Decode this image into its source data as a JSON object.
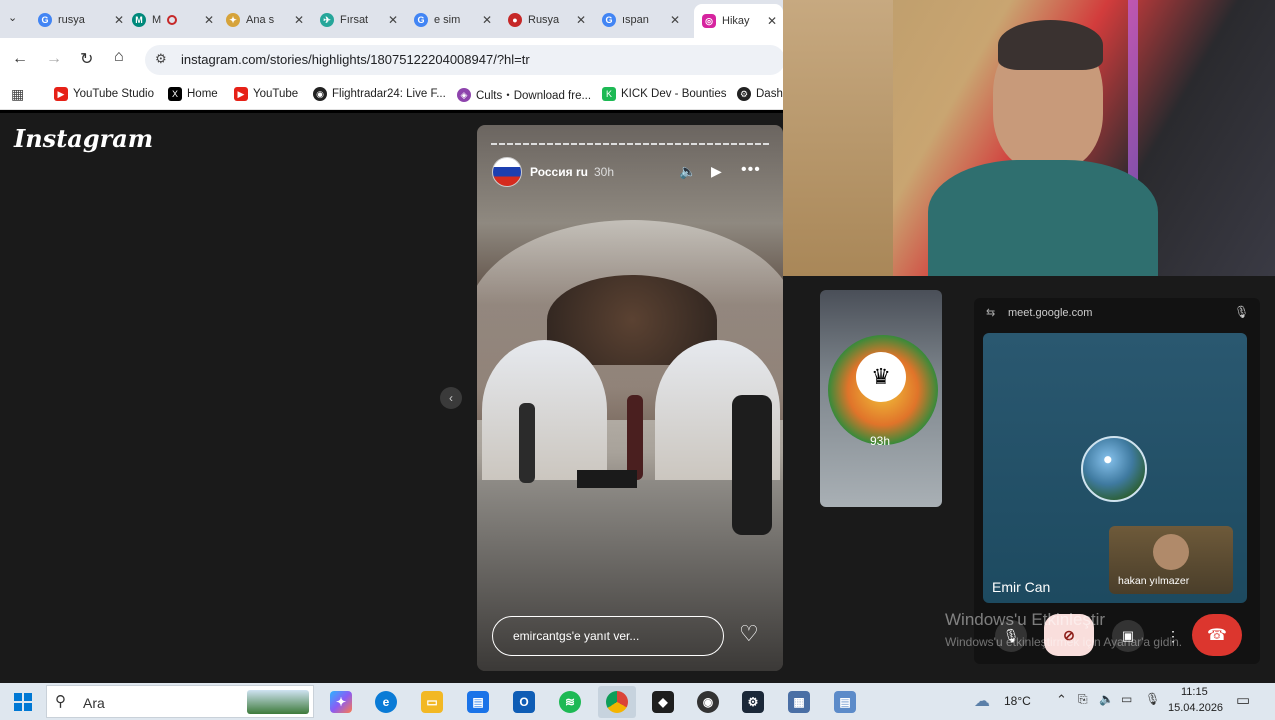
{
  "browser": {
    "tabs": [
      {
        "label": "rusya",
        "icon": "google-icon",
        "color": "#4285f4"
      },
      {
        "label": "M",
        "icon": "meet-icon",
        "color": "#00897b"
      },
      {
        "label": "Ana s",
        "icon": "page-icon",
        "color": "#d6a33a"
      },
      {
        "label": "Fırsat",
        "icon": "flight-icon",
        "color": "#26a69a"
      },
      {
        "label": "e sim",
        "icon": "google-icon",
        "color": "#4285f4"
      },
      {
        "label": "Rusya",
        "icon": "360-icon",
        "color": "#c62828"
      },
      {
        "label": "ıspan",
        "icon": "google-icon",
        "color": "#4285f4"
      },
      {
        "label": "Hikay",
        "icon": "instagram-icon",
        "color": "#d6249f"
      }
    ],
    "url": "instagram.com/stories/highlights/18075122204008947/?hl=tr",
    "bookmarks": [
      {
        "label": "YouTube Studio",
        "icon": "youtube-icon",
        "color": "#e62117"
      },
      {
        "label": "Home",
        "icon": "x-icon",
        "color": "#000000"
      },
      {
        "label": "YouTube",
        "icon": "youtube-icon",
        "color": "#e62117"
      },
      {
        "label": "Flightradar24: Live F...",
        "icon": "radar-icon",
        "color": "#222222"
      },
      {
        "label": "Cults・Download fre...",
        "icon": "cults-icon",
        "color": "#8e44ad"
      },
      {
        "label": "KICK Dev - Bounties",
        "icon": "kick-icon",
        "color": "#1db954"
      },
      {
        "label": "Dash",
        "icon": "steam-icon",
        "color": "#222222"
      }
    ]
  },
  "instagram": {
    "logo": "Instagram",
    "story": {
      "username": "Россия ru",
      "time": "30h",
      "reply_placeholder": "emircantgs'e yanıt ver..."
    },
    "next_story": {
      "time": "93h"
    }
  },
  "meet": {
    "url": "meet.google.com",
    "main_participant": "Emir Can",
    "tile_participant": "hakan yılmazer",
    "watermark_title": "Windows'u Etkinleştir",
    "watermark_sub": "Windows'u etkinleştirmek için Ayarlar'a gidin."
  },
  "taskbar": {
    "search_placeholder": "Ara",
    "weather": "18°C",
    "time": "11:15",
    "date": "15.04.2026"
  }
}
